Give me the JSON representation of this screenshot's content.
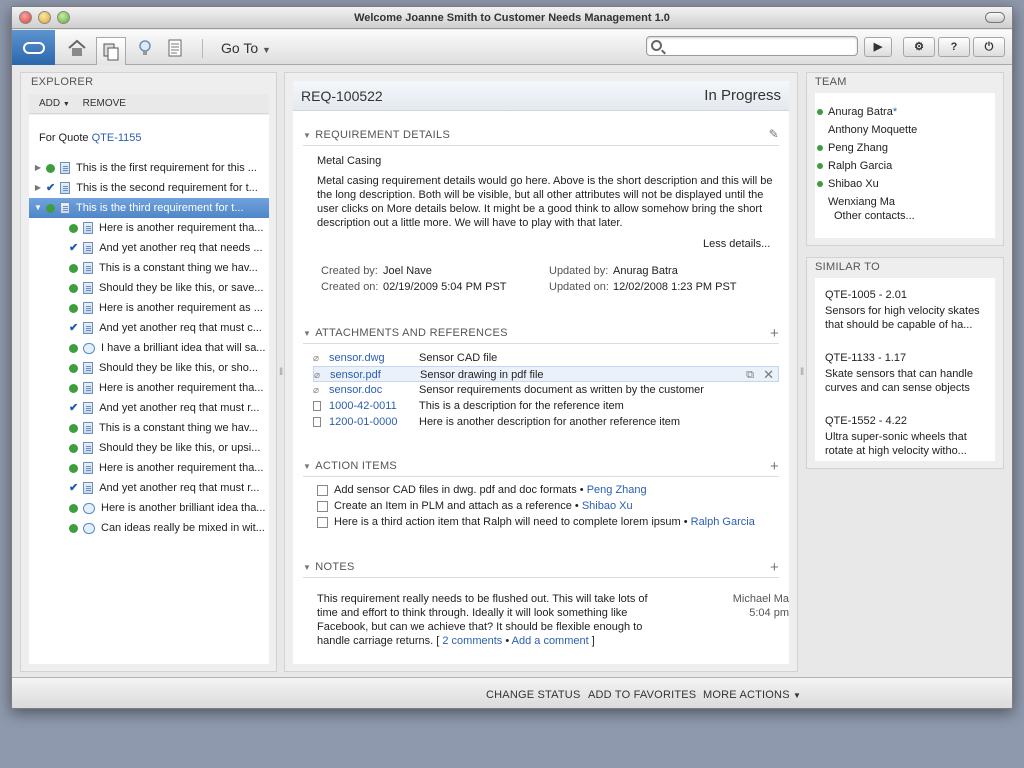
{
  "window": {
    "title": "Welcome Joanne Smith to Customer Needs Management 1.0"
  },
  "toolbar": {
    "goto_label": "Go To",
    "search": {
      "value": "",
      "placeholder": ""
    },
    "icons": [
      "oracle-logo-icon",
      "home-icon",
      "documents-icon",
      "idea-icon",
      "list-icon"
    ],
    "right_buttons": [
      "play-icon",
      "gear-icon",
      "?",
      "power-icon"
    ],
    "help_label": "?"
  },
  "explorer": {
    "title": "EXPLORER",
    "add_label": "ADD",
    "remove_label": "REMOVE",
    "quote_prefix": "For Quote ",
    "quote_link": "QTE-1155",
    "items": [
      {
        "level": 0,
        "status": "dot",
        "icon": "doc",
        "label": "This is the first requirement for this ..."
      },
      {
        "level": 0,
        "status": "check",
        "icon": "doc",
        "label": "This is the second requirement for t..."
      },
      {
        "level": 0,
        "status": "dot",
        "icon": "doc",
        "label": "This is the third requirement for t...",
        "selected": true
      },
      {
        "level": 1,
        "status": "dot",
        "icon": "doc",
        "label": "Here is another requirement tha..."
      },
      {
        "level": 1,
        "status": "check",
        "icon": "doc",
        "label": "And yet another req that needs ..."
      },
      {
        "level": 1,
        "status": "dot",
        "icon": "doc",
        "label": "This is a constant thing we hav..."
      },
      {
        "level": 1,
        "status": "dot",
        "icon": "doc",
        "label": "Should they be like this, or save..."
      },
      {
        "level": 1,
        "status": "dot",
        "icon": "doc",
        "label": "Here is another requirement as ..."
      },
      {
        "level": 1,
        "status": "check",
        "icon": "doc",
        "label": "And yet another req that must c..."
      },
      {
        "level": 1,
        "status": "dot",
        "icon": "idea",
        "label": "I have a brilliant idea that will sa..."
      },
      {
        "level": 1,
        "status": "dot",
        "icon": "doc",
        "label": "Should they be like this, or sho..."
      },
      {
        "level": 1,
        "status": "dot",
        "icon": "doc",
        "label": "Here is another requirement tha..."
      },
      {
        "level": 1,
        "status": "check",
        "icon": "doc",
        "label": "And yet another req that must r..."
      },
      {
        "level": 1,
        "status": "dot",
        "icon": "doc",
        "label": "This is a constant thing we hav..."
      },
      {
        "level": 1,
        "status": "dot",
        "icon": "doc",
        "label": "Should they be like this, or upsi..."
      },
      {
        "level": 1,
        "status": "dot",
        "icon": "doc",
        "label": "Here is another requirement tha..."
      },
      {
        "level": 1,
        "status": "check",
        "icon": "doc",
        "label": "And yet another req that must r..."
      },
      {
        "level": 1,
        "status": "dot",
        "icon": "idea",
        "label": "Here is another brilliant idea tha..."
      },
      {
        "level": 1,
        "status": "dot",
        "icon": "idea",
        "label": "Can ideas really be mixed in wit..."
      }
    ]
  },
  "detail": {
    "req_id": "REQ-100522",
    "status": "In Progress",
    "req_section": "REQUIREMENT DETAILS",
    "short_desc": "Metal Casing",
    "long_desc": "Metal casing requirement details would go here.  Above is the short description and this will be the long description.  Both will be visible, but all other attributes will not be displayed until the user clicks on More details below.  It might be a good think to allow somehow bring the short description out a little more.  We will have to play with that later.",
    "less_details": "Less details...",
    "created_by_label": "Created by:",
    "created_by": "Joel Nave",
    "created_on_label": "Created on:",
    "created_on": "02/19/2009  5:04 PM PST",
    "updated_by_label": "Updated by:",
    "updated_by": "Anurag Batra",
    "updated_on_label": "Updated on:",
    "updated_on": "12/02/2008  1:23 PM PST",
    "attach_section": "ATTACHMENTS AND REFERENCES",
    "attachments": [
      {
        "type": "clip",
        "name": "sensor.dwg",
        "desc": "Sensor CAD file"
      },
      {
        "type": "clip",
        "name": "sensor.pdf",
        "desc": "Sensor drawing in pdf file",
        "highlight": true
      },
      {
        "type": "clip",
        "name": "sensor.doc",
        "desc": "Sensor requirements document as written by the customer"
      },
      {
        "type": "page",
        "name": "1000-42-0011",
        "desc": "This is a description for the reference item"
      },
      {
        "type": "page",
        "name": "1200-01-0000",
        "desc": "Here is another description for another reference item"
      }
    ],
    "action_section": "ACTION ITEMS",
    "actions": [
      {
        "text": "Add sensor CAD files in dwg. pdf and doc formats • ",
        "who": "Peng Zhang"
      },
      {
        "text": "Create an Item in PLM and attach as a reference • ",
        "who": "Shibao Xu"
      },
      {
        "text": "Here is a third action item that Ralph will need to complete lorem ipsum • ",
        "who": "Ralph Garcia"
      }
    ],
    "notes_section": "NOTES",
    "note_text": "This requirement really needs to be flushed out.  This will take lots of time and effort to think through.  Ideally it will look something like Facebook, but can we achieve that?  It should be flexible enough to handle carriage returns. [ ",
    "note_comments": "2 comments",
    "note_sep": " • ",
    "note_add": "Add a comment",
    "note_close": " ]",
    "note_author": "Michael Ma",
    "note_time": "5:04 pm"
  },
  "team": {
    "title": "TEAM",
    "members": [
      {
        "name": "Anurag Batra",
        "online": true,
        "star": "*"
      },
      {
        "name": "Anthony Moquette",
        "online": false
      },
      {
        "name": "Peng Zhang",
        "online": true
      },
      {
        "name": "Ralph Garcia",
        "online": true
      },
      {
        "name": "Shibao Xu",
        "online": true
      },
      {
        "name": "Wenxiang Ma",
        "online": false
      }
    ],
    "other_contacts": "Other contacts..."
  },
  "similar": {
    "title": "SIMILAR TO",
    "items": [
      {
        "id": "QTE-1005 - 2.01",
        "desc": "Sensors for high velocity skates that should be capable of ha..."
      },
      {
        "id": "QTE-1133 - 1.17",
        "desc": "Skate sensors that can handle curves and can sense objects"
      },
      {
        "id": "QTE-1552 - 4.22",
        "desc": "Ultra super-sonic wheels that rotate at high velocity witho..."
      }
    ]
  },
  "bottom": {
    "change_status": "CHANGE STATUS",
    "add_favorites": "ADD TO FAVORITES",
    "more_actions": "MORE ACTIONS"
  },
  "colors": {
    "accent": "#2b5fb0",
    "selected_row": "#5a8fd0",
    "status_green": "#3d9e3d"
  }
}
